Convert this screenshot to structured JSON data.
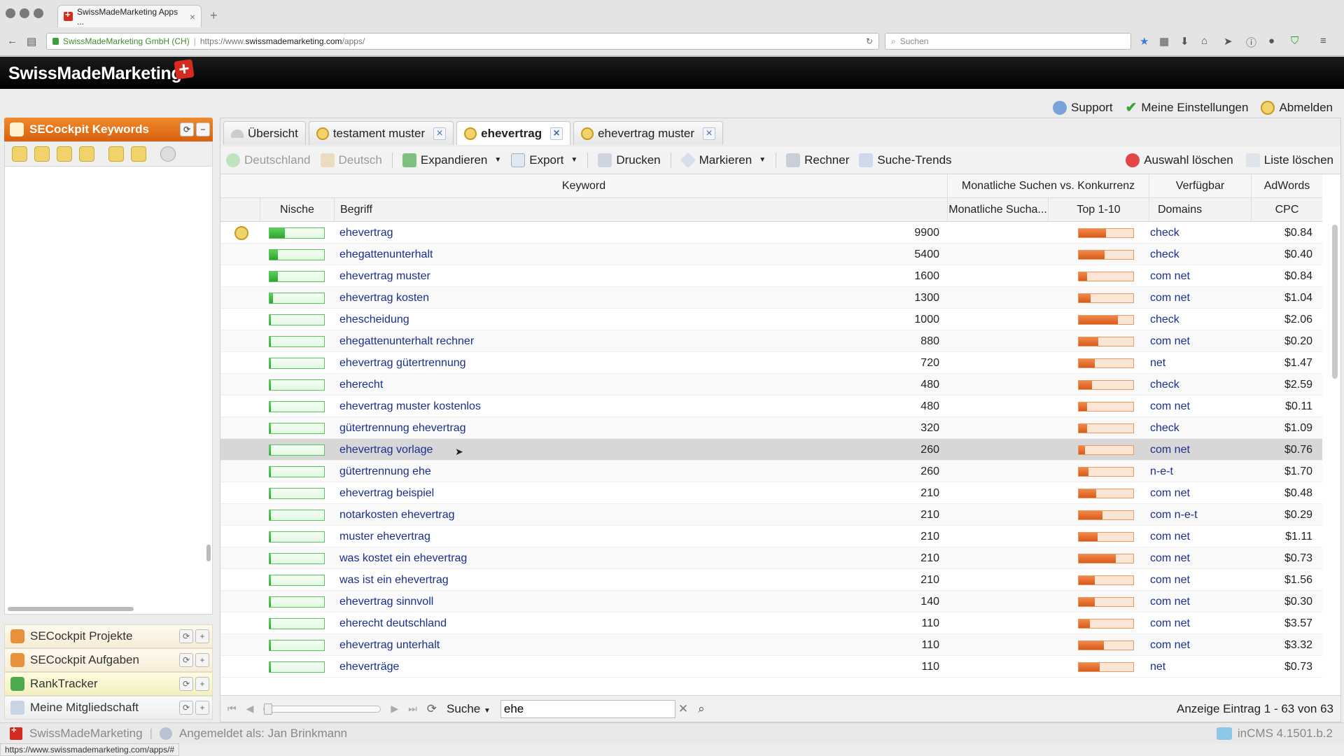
{
  "browser": {
    "tab_title": "SwissMadeMarketing Apps ...",
    "url_org": "SwissMadeMarketing GmbH (CH)",
    "url_scheme": "https://www.",
    "url_host": "swissmademarketing.com",
    "url_path": "/apps/",
    "search_placeholder": "Suchen",
    "status_url": "https://www.swissmademarketing.com/apps/#"
  },
  "app": {
    "brand": "SwissMadeMarketing",
    "top_links": [
      "Support",
      "Meine Einstellungen",
      "Abmelden"
    ]
  },
  "sidebar": {
    "title": "SECockpit Keywords",
    "items": [
      "SECockpit Projekte",
      "SECockpit Aufgaben",
      "RankTracker",
      "Meine Mitgliedschaft"
    ]
  },
  "tabs": [
    {
      "label": "Übersicht",
      "closable": false
    },
    {
      "label": "testament muster",
      "closable": true
    },
    {
      "label": "ehevertrag",
      "closable": true,
      "active": true
    },
    {
      "label": "ehevertrag muster",
      "closable": true
    }
  ],
  "toolbar": {
    "country": "Deutschland",
    "language": "Deutsch",
    "expand": "Expandieren",
    "export": "Export",
    "print": "Drucken",
    "mark": "Markieren",
    "calculator": "Rechner",
    "trends": "Suche-Trends",
    "clear_selection": "Auswahl löschen",
    "clear_list": "Liste löschen"
  },
  "grid": {
    "group_headers": {
      "keyword": "Keyword",
      "searches_vs_competition": "Monatliche Suchen vs. Konkurrenz",
      "available": "Verfügbar",
      "adwords": "AdWords"
    },
    "columns": {
      "niche": "Nische",
      "term": "Begriff",
      "monthly": "Monatliche Sucha...",
      "top": "Top 1-10",
      "domains": "Domains",
      "cpc": "CPC"
    },
    "rows": [
      {
        "term": "ehevertrag",
        "searches": "9900",
        "domains": "check",
        "cpc": "$0.84",
        "niche": 0.28,
        "competition": 0.5,
        "starred": true
      },
      {
        "term": "ehegattenunterhalt",
        "searches": "5400",
        "domains": "check",
        "cpc": "$0.40",
        "niche": 0.16,
        "competition": 0.48
      },
      {
        "term": "ehevertrag muster",
        "searches": "1600",
        "domains": "com net",
        "cpc": "$0.84",
        "niche": 0.16,
        "competition": 0.15
      },
      {
        "term": "ehevertrag kosten",
        "searches": "1300",
        "domains": "com net",
        "cpc": "$1.04",
        "niche": 0.07,
        "competition": 0.22
      },
      {
        "term": "ehescheidung",
        "searches": "1000",
        "domains": "check",
        "cpc": "$2.06",
        "niche": 0.03,
        "competition": 0.72
      },
      {
        "term": "ehegattenunterhalt rechner",
        "searches": "880",
        "domains": "com net",
        "cpc": "$0.20",
        "niche": 0.03,
        "competition": 0.36
      },
      {
        "term": "ehevertrag gütertrennung",
        "searches": "720",
        "domains": "net",
        "cpc": "$1.47",
        "niche": 0.03,
        "competition": 0.3
      },
      {
        "term": "eherecht",
        "searches": "480",
        "domains": "check",
        "cpc": "$2.59",
        "niche": 0.03,
        "competition": 0.24
      },
      {
        "term": "ehevertrag muster kostenlos",
        "searches": "480",
        "domains": "com net",
        "cpc": "$0.11",
        "niche": 0.03,
        "competition": 0.15
      },
      {
        "term": "gütertrennung ehevertrag",
        "searches": "320",
        "domains": "check",
        "cpc": "$1.09",
        "niche": 0.02,
        "competition": 0.15
      },
      {
        "term": "ehevertrag vorlage",
        "searches": "260",
        "domains": "com net",
        "cpc": "$0.76",
        "niche": 0.02,
        "competition": 0.12,
        "selected": true
      },
      {
        "term": "gütertrennung ehe",
        "searches": "260",
        "domains": "n-e-t",
        "cpc": "$1.70",
        "niche": 0.02,
        "competition": 0.18
      },
      {
        "term": "ehevertrag beispiel",
        "searches": "210",
        "domains": "com net",
        "cpc": "$0.48",
        "niche": 0.02,
        "competition": 0.32
      },
      {
        "term": "notarkosten ehevertrag",
        "searches": "210",
        "domains": "com n-e-t",
        "cpc": "$0.29",
        "niche": 0.02,
        "competition": 0.44
      },
      {
        "term": "muster ehevertrag",
        "searches": "210",
        "domains": "com net",
        "cpc": "$1.11",
        "niche": 0.02,
        "competition": 0.34
      },
      {
        "term": "was kostet ein ehevertrag",
        "searches": "210",
        "domains": "com net",
        "cpc": "$0.73",
        "niche": 0.02,
        "competition": 0.68
      },
      {
        "term": "was ist ein ehevertrag",
        "searches": "210",
        "domains": "com net",
        "cpc": "$1.56",
        "niche": 0.02,
        "competition": 0.3
      },
      {
        "term": "ehevertrag sinnvoll",
        "searches": "140",
        "domains": "com net",
        "cpc": "$0.30",
        "niche": 0.02,
        "competition": 0.3
      },
      {
        "term": "eherecht deutschland",
        "searches": "110",
        "domains": "com net",
        "cpc": "$3.57",
        "niche": 0.02,
        "competition": 0.2
      },
      {
        "term": "ehevertrag unterhalt",
        "searches": "110",
        "domains": "com net",
        "cpc": "$3.32",
        "niche": 0.02,
        "competition": 0.46
      },
      {
        "term": "eheverträge",
        "searches": "110",
        "domains": "net",
        "cpc": "$0.73",
        "niche": 0.02,
        "competition": 0.38
      }
    ]
  },
  "pager": {
    "search_label": "Suche",
    "search_value": "ehe",
    "info": "Anzeige Eintrag 1 - 63 von 63"
  },
  "statusbar": {
    "brand": "SwissMadeMarketing",
    "logged_in": "Angemeldet als: Jan Brinkmann",
    "version": "inCMS 4.1501.b.2"
  },
  "colors": {
    "accent_orange": "#e8761f",
    "link_blue": "#1a2f8f",
    "niche_green": "#2fa32f",
    "competition_orange": "#e06a28",
    "brand_red": "#d52b1e"
  }
}
